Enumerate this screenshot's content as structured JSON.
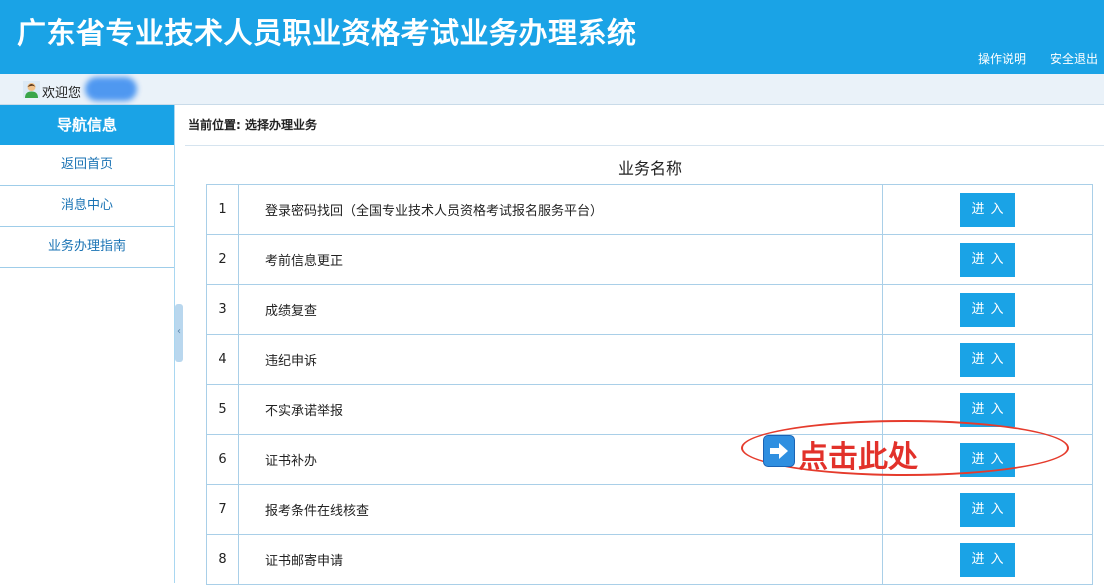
{
  "header": {
    "title": "广东省专业技术人员职业资格考试业务办理系统",
    "links": [
      "操作说明",
      "安全退出"
    ]
  },
  "userbar": {
    "welcome": "欢迎您"
  },
  "sidebar": {
    "heading": "导航信息",
    "items": [
      {
        "label": "返回首页"
      },
      {
        "label": "消息中心"
      },
      {
        "label": "业务办理指南"
      }
    ]
  },
  "main": {
    "breadcrumb": "当前位置: 选择办理业务",
    "table_caption": "业务名称",
    "enter_label": "进入",
    "rows": [
      {
        "no": "1",
        "name": "登录密码找回（全国专业技术人员资格考试报名服务平台）"
      },
      {
        "no": "2",
        "name": "考前信息更正"
      },
      {
        "no": "3",
        "name": "成绩复查"
      },
      {
        "no": "4",
        "name": "违纪申诉"
      },
      {
        "no": "5",
        "name": "不实承诺举报"
      },
      {
        "no": "6",
        "name": "证书补办"
      },
      {
        "no": "7",
        "name": "报考条件在线核查"
      },
      {
        "no": "8",
        "name": "证书邮寄申请"
      }
    ]
  },
  "annotation": {
    "text": "点击此处",
    "icon": "right-arrow-icon",
    "color": "#e2312a"
  },
  "colors": {
    "primary": "#1aa3e6",
    "accent_red": "#e53b2c"
  }
}
